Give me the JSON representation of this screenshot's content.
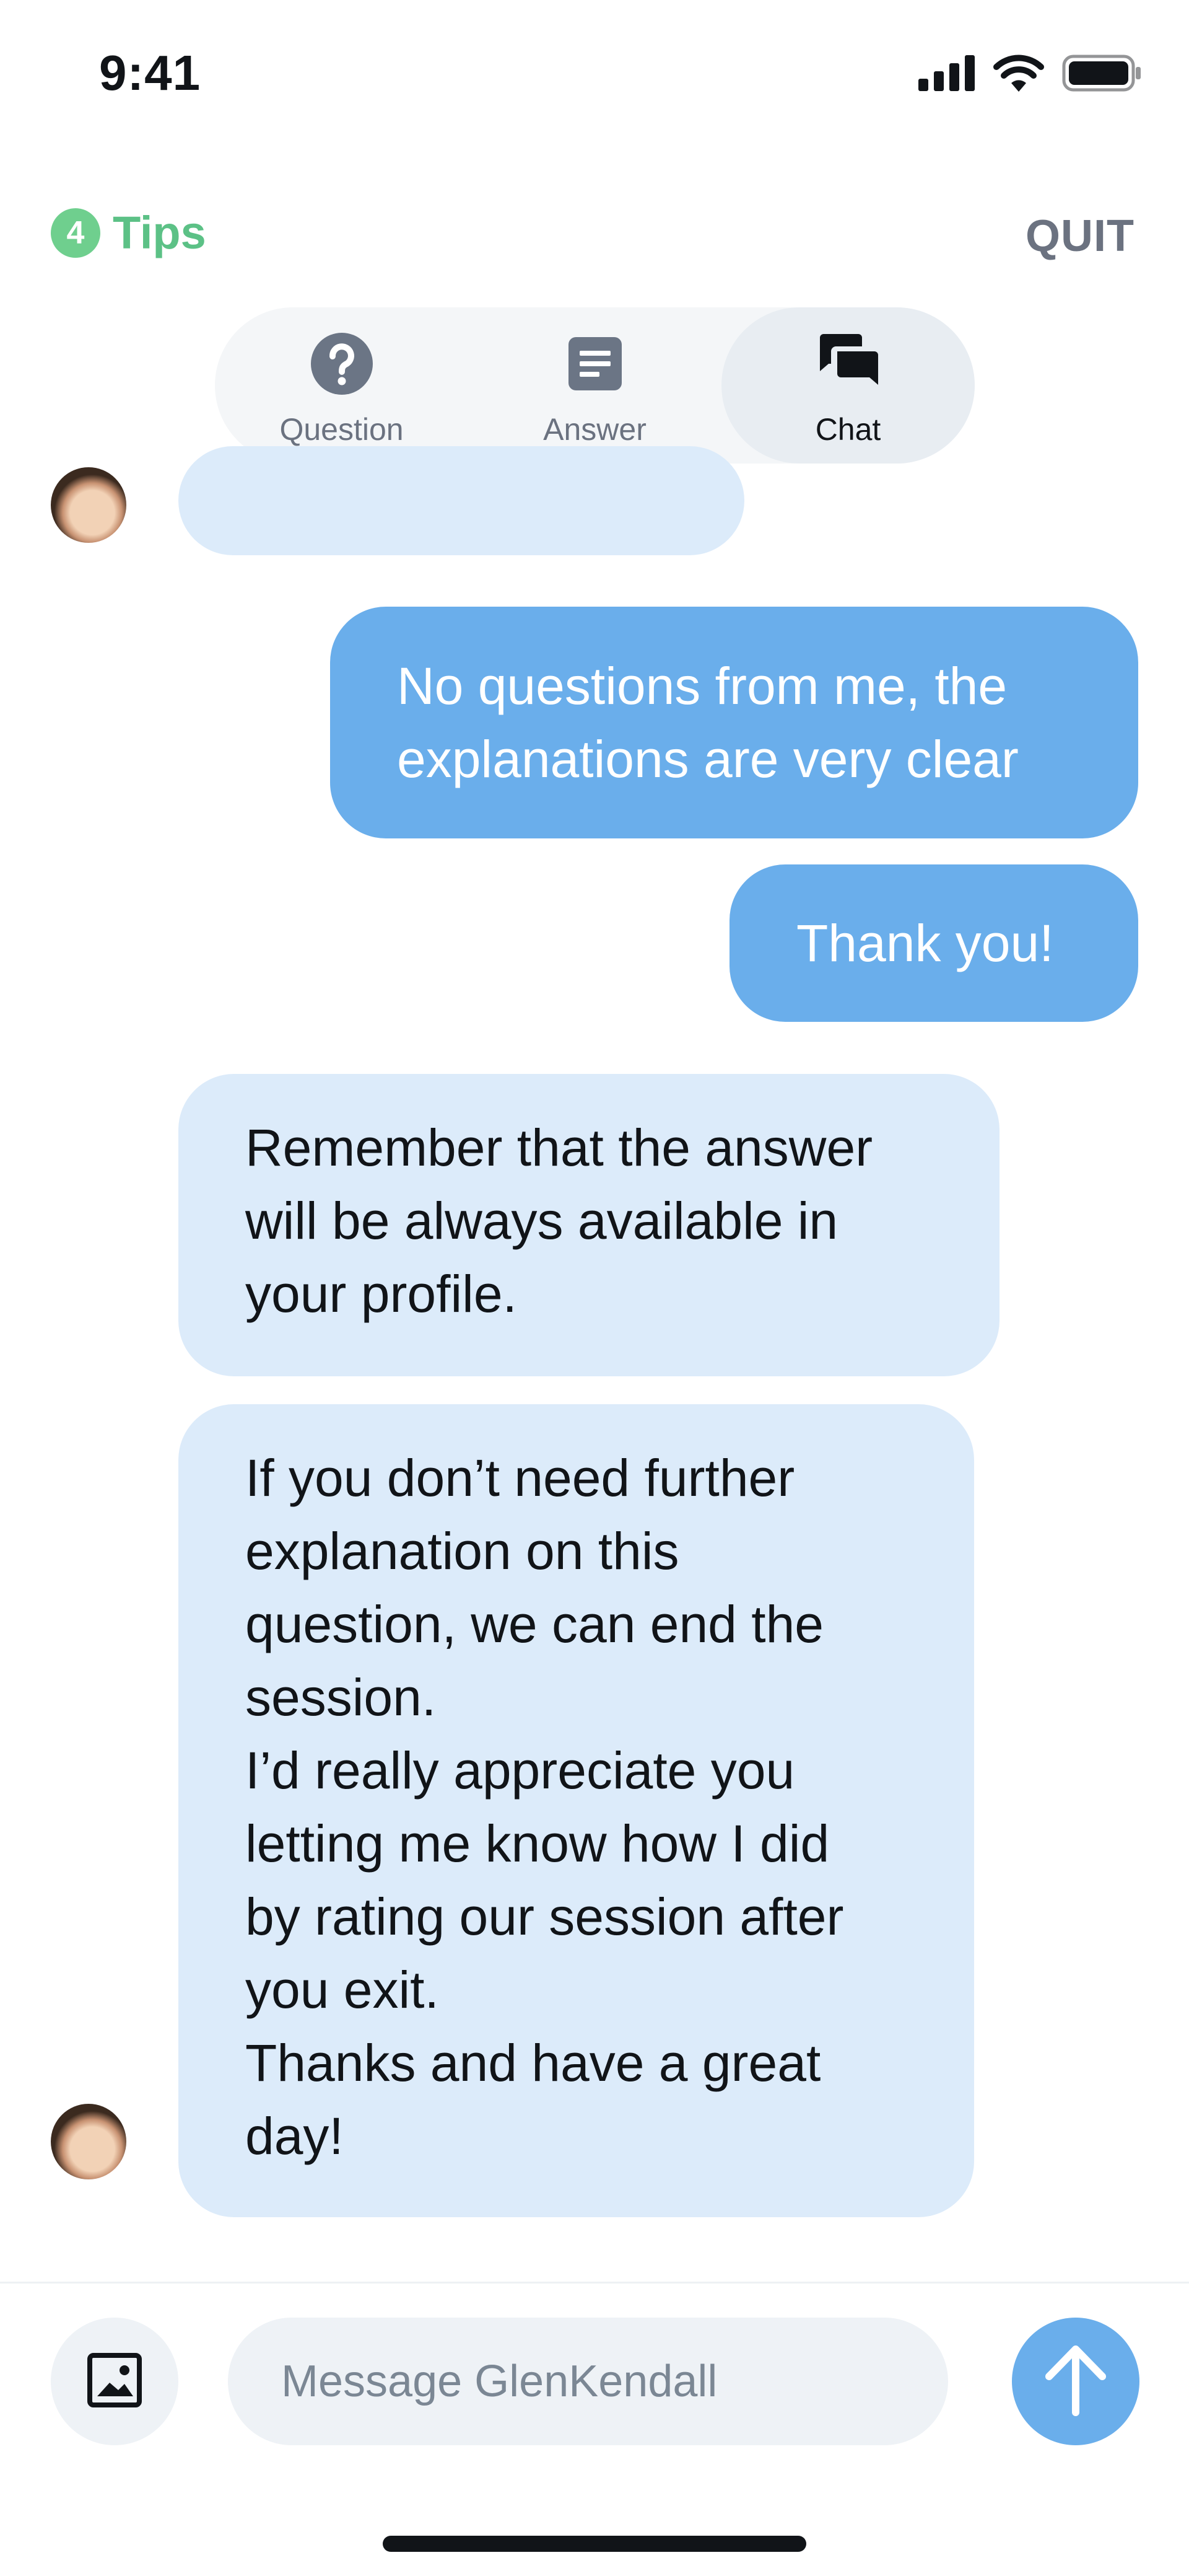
{
  "status_bar": {
    "time": "9:41"
  },
  "header": {
    "tips_count": "4",
    "tips_label": "Tips",
    "quit_label": "QUIT"
  },
  "tabs": [
    {
      "label": "Question",
      "icon": "question-circle-icon",
      "active": false
    },
    {
      "label": "Answer",
      "icon": "document-lines-icon",
      "active": false
    },
    {
      "label": "Chat",
      "icon": "chat-bubbles-icon",
      "active": true
    }
  ],
  "messages": [
    {
      "from": "other",
      "text": ""
    },
    {
      "from": "me",
      "text": "No questions from me, the\nexplanations are very clear"
    },
    {
      "from": "me",
      "text": "Thank you!"
    },
    {
      "from": "other",
      "text": "Remember that the answer\nwill be always available in\nyour profile."
    },
    {
      "from": "other",
      "text": "If you don’t need further\nexplanation on this\nquestion, we can end the\nsession.\nI’d really appreciate you\nletting me know how I did\nby rating our session after\nyou exit.\nThanks and have a great\nday!"
    }
  ],
  "composer": {
    "placeholder": "Message GlenKendall",
    "attach_icon": "image-icon",
    "send_icon": "arrow-up-icon"
  },
  "colors": {
    "accent_green": "#5cc186",
    "sent_bubble": "#6aaeeb",
    "received_bubble": "#dcebfa",
    "muted_text": "#6b7280"
  }
}
